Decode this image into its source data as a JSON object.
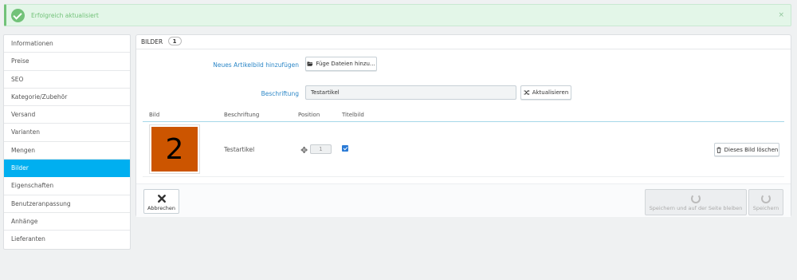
{
  "alert": {
    "message": "Erfolgreich aktualisiert",
    "close": "×",
    "accent": "#72c279"
  },
  "sidebar": {
    "active_color": "#00aff0",
    "items": [
      {
        "label": "Informationen"
      },
      {
        "label": "Preise"
      },
      {
        "label": "SEO"
      },
      {
        "label": "Kategorie/Zubehör"
      },
      {
        "label": "Versand"
      },
      {
        "label": "Varianten"
      },
      {
        "label": "Mengen"
      },
      {
        "label": "Bilder",
        "active": true
      },
      {
        "label": "Eigenschaften"
      },
      {
        "label": "Benutzeranpassung"
      },
      {
        "label": "Anhänge"
      },
      {
        "label": "Lieferanten"
      }
    ]
  },
  "panel": {
    "title": "BILDER",
    "count": "1",
    "new_image_label": "Neues Artikelbild hinzufügen",
    "add_files_button": "Füge Dateien hinzu...",
    "caption_label": "Beschriftung",
    "caption_value": "Testartikel",
    "update_button": "Aktualisieren"
  },
  "table": {
    "headers": {
      "image": "Bild",
      "caption": "Beschriftung",
      "position": "Position",
      "cover": "Titelbild"
    },
    "rows": [
      {
        "thumb_text": "2",
        "thumb_color": "#cc5500",
        "caption": "Testartikel",
        "position": "1",
        "cover": true,
        "delete_button": "Dieses Bild löschen"
      }
    ]
  },
  "footer": {
    "cancel": "Abbrechen",
    "save_stay": "Speichern und auf der Seite bleiben",
    "save": "Speichern"
  }
}
